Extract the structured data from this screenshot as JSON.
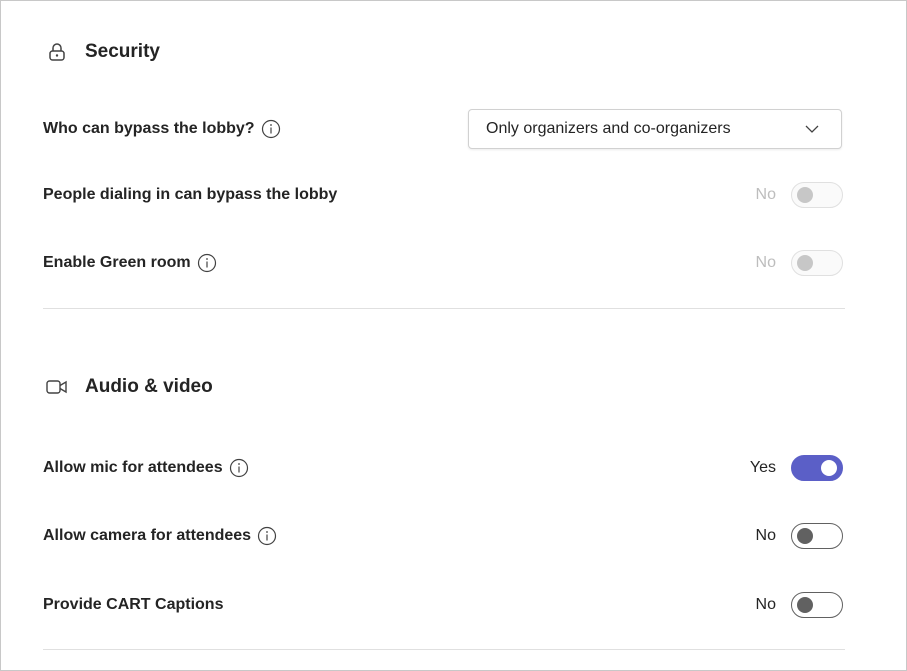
{
  "security": {
    "title": "Security",
    "lobby_bypass": {
      "label": "Who can bypass the lobby?",
      "selected": "Only organizers and co-organizers"
    },
    "dial_in_bypass": {
      "label": "People dialing in can bypass the lobby",
      "state": "No",
      "enabled": false
    },
    "green_room": {
      "label": "Enable Green room",
      "state": "No",
      "enabled": false
    }
  },
  "audio_video": {
    "title": "Audio & video",
    "allow_mic": {
      "label": "Allow mic for attendees",
      "state": "Yes",
      "on": true
    },
    "allow_camera": {
      "label": "Allow camera for attendees",
      "state": "No",
      "on": false
    },
    "cart_captions": {
      "label": "Provide CART Captions",
      "state": "No",
      "on": false
    }
  },
  "colors": {
    "accent": "#5b5fc7",
    "text": "#242424",
    "disabled_text": "#bdbdbd",
    "divider": "#e0e0e0"
  },
  "icons": [
    "lock-icon",
    "info-icon",
    "chevron-down-icon",
    "video-camera-icon"
  ]
}
